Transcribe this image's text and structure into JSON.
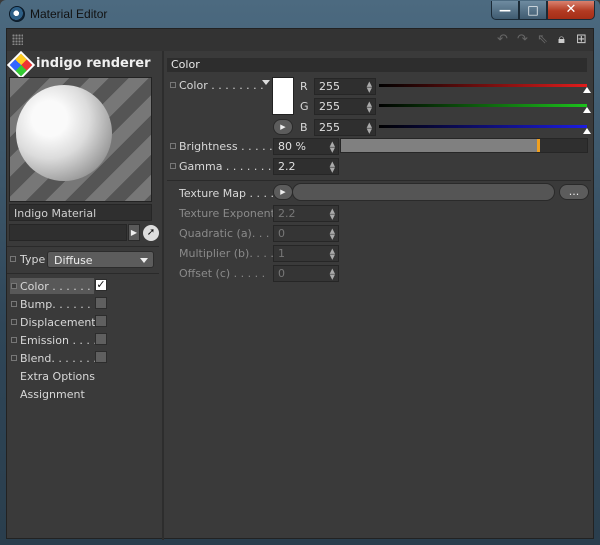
{
  "window": {
    "title": "Material Editor",
    "min_glyph": "—",
    "max_glyph": "□",
    "close_glyph": "✕"
  },
  "left": {
    "renderer_title": "indigo renderer",
    "material_name": "Indigo Material",
    "type_label": "Type",
    "type_value": "Diffuse",
    "channels": [
      {
        "label": "Color . . . . . . .",
        "checked": true
      },
      {
        "label": "Bump. . . . . . .",
        "checked": false
      },
      {
        "label": "Displacement",
        "checked": false
      },
      {
        "label": "Emission . . . .",
        "checked": false
      },
      {
        "label": "Blend. . . . . . .",
        "checked": false
      }
    ],
    "extra_options": "Extra Options",
    "assignment": "Assignment",
    "check_glyph": "✓"
  },
  "right": {
    "section_title": "Color",
    "color_label": "Color . . . . . . . .",
    "r_label": "R",
    "g_label": "G",
    "b_label": "B",
    "r_value": "255",
    "g_value": "255",
    "b_value": "255",
    "r": 1.0,
    "g": 1.0,
    "b": 1.0,
    "brightness_label": "Brightness . . . . .",
    "brightness_value": "80 %",
    "brightness": 0.8,
    "gamma_label": "Gamma . . . . . . . .",
    "gamma_value": "2.2",
    "texture_map_label": "Texture Map . . . .",
    "texture_button": "...",
    "texture_exponent_label": "Texture Exponent",
    "texture_exponent_value": "2.2",
    "quadratic_label": "Quadratic (a). . . .",
    "quadratic_value": "0",
    "multiplier_label": "Multiplier (b). . . .",
    "multiplier_value": "1",
    "offset_label": "Offset (c) . . . . .",
    "offset_value": "0"
  },
  "colors": {
    "red": "#e01c1c",
    "green": "#1cc21c",
    "blue": "#1c1ce0",
    "accent": "#f0a020",
    "swatch": "#ffffff"
  }
}
